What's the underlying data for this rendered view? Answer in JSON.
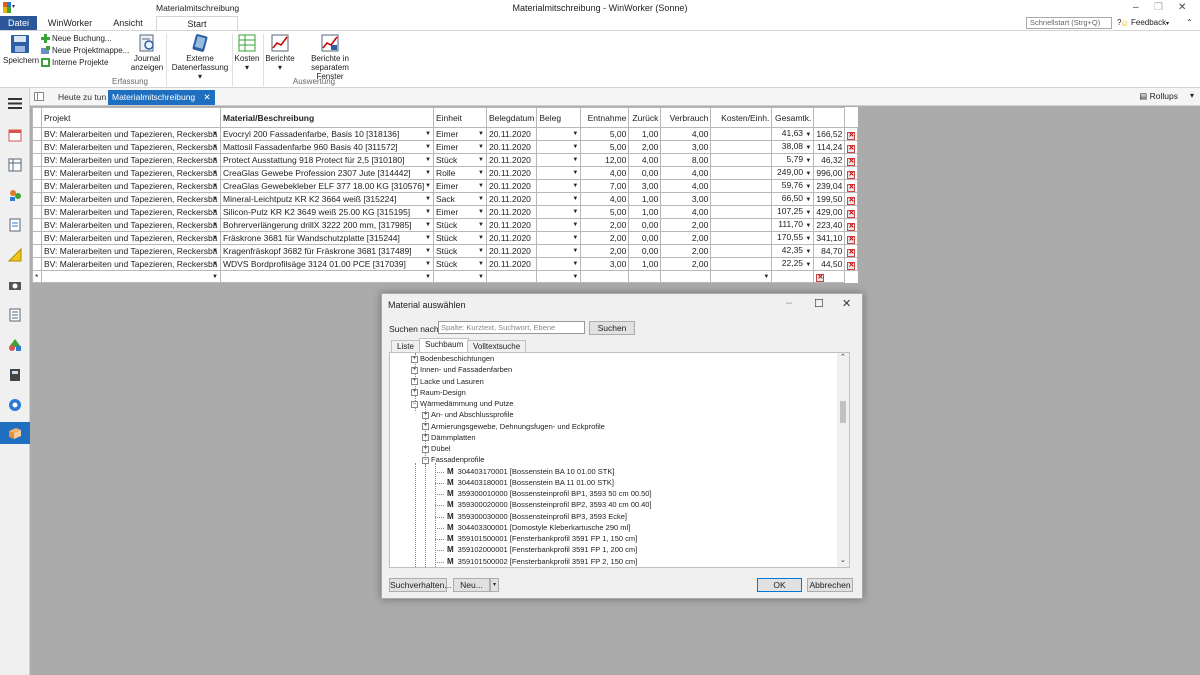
{
  "window": {
    "title": "Materialmitschreibung - WinWorker (Sonne)",
    "context_tab_group": "Materialmitschreibung"
  },
  "ribbon_tabs": {
    "file": "Datei",
    "winworker": "WinWorker",
    "view": "Ansicht",
    "start": "Start"
  },
  "quick_start": {
    "placeholder": "Schnellstart (Strg+Q)"
  },
  "feedback": "Feedback",
  "ribbon": {
    "save": "Speichern",
    "new_booking": "Neue Buchung...",
    "new_project_folder": "Neue Projektmappe...",
    "internal_projects": "Interne Projekte",
    "journal": "Journal anzeigen",
    "external": "Externe Datenerfassung",
    "costs": "Kosten",
    "reports": "Berichte",
    "reports_window": "Berichte in separatem Fenster",
    "group_capture": "Erfassung",
    "group_eval": "Auswertung"
  },
  "doc_tabs": {
    "today": "Heute zu tun",
    "material": "Materialmitschreibung",
    "rollups": "Rollups"
  },
  "grid": {
    "headers": [
      "Projekt",
      "Material/Beschreibung",
      "Einheit",
      "Belegdatum",
      "Beleg",
      "Entnahme",
      "Zurück",
      "Verbrauch",
      "Kosten/Einh.",
      "Gesamtk."
    ],
    "rows": [
      {
        "project": "BV: Malerarbeiten und Tapezieren, Reckersba",
        "material": "Evocryl 200 Fassadenfarbe, Basis 10 [318136]",
        "unit": "Eimer",
        "date": "20.11.2020",
        "doc": "",
        "withdrawal": "5,00",
        "returned": "1,00",
        "consumption": "4,00",
        "cost_unit": "41,63",
        "total": "166,52"
      },
      {
        "project": "BV: Malerarbeiten und Tapezieren, Reckersba",
        "material": "Mattosil Fassadenfarbe 960 Basis 40 [311572]",
        "unit": "Eimer",
        "date": "20.11.2020",
        "doc": "",
        "withdrawal": "5,00",
        "returned": "2,00",
        "consumption": "3,00",
        "cost_unit": "38,08",
        "total": "114,24"
      },
      {
        "project": "BV: Malerarbeiten und Tapezieren, Reckersba",
        "material": "Protect Ausstattung 918 Protect für 2,5 [310180]",
        "unit": "Stück",
        "date": "20.11.2020",
        "doc": "",
        "withdrawal": "12,00",
        "returned": "4,00",
        "consumption": "8,00",
        "cost_unit": "5,79",
        "total": "46,32"
      },
      {
        "project": "BV: Malerarbeiten und Tapezieren, Reckersba",
        "material": "CreaGlas Gewebe Profession 2307 Jute [314442]",
        "unit": "Rolle",
        "date": "20.11.2020",
        "doc": "",
        "withdrawal": "4,00",
        "returned": "0,00",
        "consumption": "4,00",
        "cost_unit": "249,00",
        "total": "996,00"
      },
      {
        "project": "BV: Malerarbeiten und Tapezieren, Reckersba",
        "material": "CreaGlas Gewebekleber ELF 377  18.00 KG [310576]",
        "unit": "Eimer",
        "date": "20.11.2020",
        "doc": "",
        "withdrawal": "7,00",
        "returned": "3,00",
        "consumption": "4,00",
        "cost_unit": "59,76",
        "total": "239,04"
      },
      {
        "project": "BV: Malerarbeiten und Tapezieren, Reckersba",
        "material": "Mineral-Leichtputz KR K2 3664 weiß [315224]",
        "unit": "Sack",
        "date": "20.11.2020",
        "doc": "",
        "withdrawal": "4,00",
        "returned": "1,00",
        "consumption": "3,00",
        "cost_unit": "66,50",
        "total": "199,50"
      },
      {
        "project": "BV: Malerarbeiten und Tapezieren, Reckersba",
        "material": "Silicon-Putz KR K2 3649 weiß 25.00 KG [315195]",
        "unit": "Eimer",
        "date": "20.11.2020",
        "doc": "",
        "withdrawal": "5,00",
        "returned": "1,00",
        "consumption": "4,00",
        "cost_unit": "107,25",
        "total": "429,00"
      },
      {
        "project": "BV: Malerarbeiten und Tapezieren, Reckersba",
        "material": "Bohrerverlängerung drillX 3222 200 mm, [317985]",
        "unit": "Stück",
        "date": "20.11.2020",
        "doc": "",
        "withdrawal": "2,00",
        "returned": "0,00",
        "consumption": "2,00",
        "cost_unit": "111,70",
        "total": "223,40"
      },
      {
        "project": "BV: Malerarbeiten und Tapezieren, Reckersba",
        "material": "Fräskrone 3681 für Wandschutzplatte [315244]",
        "unit": "Stück",
        "date": "20.11.2020",
        "doc": "",
        "withdrawal": "2,00",
        "returned": "0,00",
        "consumption": "2,00",
        "cost_unit": "170,55",
        "total": "341,10"
      },
      {
        "project": "BV: Malerarbeiten und Tapezieren, Reckersba",
        "material": "Kragenfräskopf 3682 für Fräskrone 3681 [317489]",
        "unit": "Stück",
        "date": "20.11.2020",
        "doc": "",
        "withdrawal": "2,00",
        "returned": "0,00",
        "consumption": "2,00",
        "cost_unit": "42,35",
        "total": "84,70"
      },
      {
        "project": "BV: Malerarbeiten und Tapezieren, Reckersba",
        "material": "WDVS Bordprofilsäge 3124  01.00 PCE [317039]",
        "unit": "Stück",
        "date": "20.11.2020",
        "doc": "",
        "withdrawal": "3,00",
        "returned": "1,00",
        "consumption": "2,00",
        "cost_unit": "22,25",
        "total": "44,50"
      }
    ],
    "new_row_marker": "*"
  },
  "dialog": {
    "title": "Material auswählen",
    "search_label": "Suchen nach:",
    "search_placeholder": "Spalte: Kurztext, Suchwort, Ebene",
    "search_button": "Suchen",
    "tabs": [
      "Liste",
      "Suchbaum",
      "Volltextsuche"
    ],
    "tree": {
      "top": [
        "Bodenbeschichtungen",
        "Innen- und Fassadenfarben",
        "Lacke und Lasuren",
        "Raum-Design",
        "Wärmedämmung und Putze"
      ],
      "sub": [
        "An- und Abschlussprofile",
        "Armierungsgewebe, Dehnungsfugen- und Eckprofile",
        "Dämmplatten",
        "Dübel",
        "Fassadenprofile"
      ],
      "leaves": [
        "304403170001 [Bossenstein BA 10 01.00 STK]",
        "304403180001 [Bossenstein BA 11 01.00 STK]",
        "359300010000 [Bossensteinprofil BP1, 3593 50 cm 00.50]",
        "359300020000 [Bossensteinprofil BP2, 3593 40 cm 00.40]",
        "359300030000 [Bossensteinprofil BP3, 3593 Ecke]",
        "304403300001 [Domostyle Kleberkartusche 290 ml]",
        "359101500001 [Fensterbankprofil 3591 FP 1, 150 cm]",
        "359102000001 [Fensterbankprofil 3591 FP 1, 200 cm]",
        "359101500002 [Fensterbankprofil 3591 FP 2, 150 cm]"
      ],
      "leaf_marker": "M"
    },
    "footer": {
      "search_behavior": "Suchverhalten...",
      "new": "Neu...",
      "ok": "OK",
      "cancel": "Abbrechen"
    }
  },
  "colors": {
    "accent": "#1e6fc0",
    "file_tab": "#2b579a",
    "workspace": "#ababab",
    "delete": "#cc0000"
  }
}
